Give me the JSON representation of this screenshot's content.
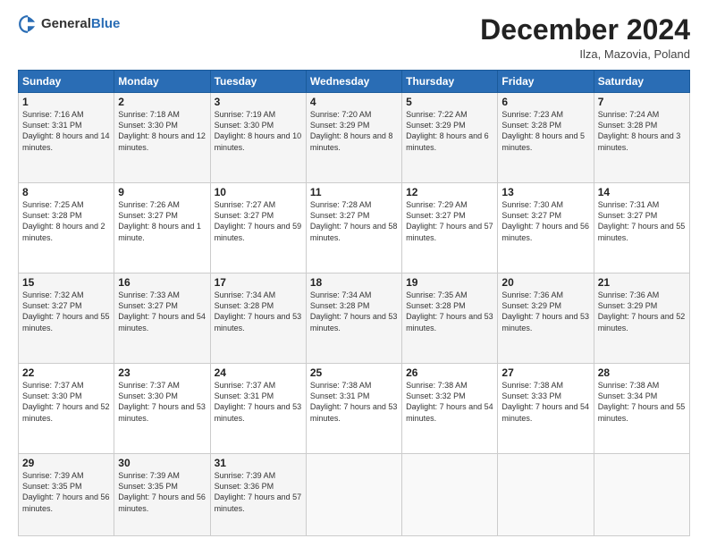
{
  "header": {
    "logo_general": "General",
    "logo_blue": "Blue",
    "month_title": "December 2024",
    "location": "Ilza, Mazovia, Poland"
  },
  "days_of_week": [
    "Sunday",
    "Monday",
    "Tuesday",
    "Wednesday",
    "Thursday",
    "Friday",
    "Saturday"
  ],
  "weeks": [
    [
      {
        "day": "1",
        "sunrise": "7:16 AM",
        "sunset": "3:31 PM",
        "daylight": "8 hours and 14 minutes."
      },
      {
        "day": "2",
        "sunrise": "7:18 AM",
        "sunset": "3:30 PM",
        "daylight": "8 hours and 12 minutes."
      },
      {
        "day": "3",
        "sunrise": "7:19 AM",
        "sunset": "3:30 PM",
        "daylight": "8 hours and 10 minutes."
      },
      {
        "day": "4",
        "sunrise": "7:20 AM",
        "sunset": "3:29 PM",
        "daylight": "8 hours and 8 minutes."
      },
      {
        "day": "5",
        "sunrise": "7:22 AM",
        "sunset": "3:29 PM",
        "daylight": "8 hours and 6 minutes."
      },
      {
        "day": "6",
        "sunrise": "7:23 AM",
        "sunset": "3:28 PM",
        "daylight": "8 hours and 5 minutes."
      },
      {
        "day": "7",
        "sunrise": "7:24 AM",
        "sunset": "3:28 PM",
        "daylight": "8 hours and 3 minutes."
      }
    ],
    [
      {
        "day": "8",
        "sunrise": "7:25 AM",
        "sunset": "3:28 PM",
        "daylight": "8 hours and 2 minutes."
      },
      {
        "day": "9",
        "sunrise": "7:26 AM",
        "sunset": "3:27 PM",
        "daylight": "8 hours and 1 minute."
      },
      {
        "day": "10",
        "sunrise": "7:27 AM",
        "sunset": "3:27 PM",
        "daylight": "7 hours and 59 minutes."
      },
      {
        "day": "11",
        "sunrise": "7:28 AM",
        "sunset": "3:27 PM",
        "daylight": "7 hours and 58 minutes."
      },
      {
        "day": "12",
        "sunrise": "7:29 AM",
        "sunset": "3:27 PM",
        "daylight": "7 hours and 57 minutes."
      },
      {
        "day": "13",
        "sunrise": "7:30 AM",
        "sunset": "3:27 PM",
        "daylight": "7 hours and 56 minutes."
      },
      {
        "day": "14",
        "sunrise": "7:31 AM",
        "sunset": "3:27 PM",
        "daylight": "7 hours and 55 minutes."
      }
    ],
    [
      {
        "day": "15",
        "sunrise": "7:32 AM",
        "sunset": "3:27 PM",
        "daylight": "7 hours and 55 minutes."
      },
      {
        "day": "16",
        "sunrise": "7:33 AM",
        "sunset": "3:27 PM",
        "daylight": "7 hours and 54 minutes."
      },
      {
        "day": "17",
        "sunrise": "7:34 AM",
        "sunset": "3:28 PM",
        "daylight": "7 hours and 53 minutes."
      },
      {
        "day": "18",
        "sunrise": "7:34 AM",
        "sunset": "3:28 PM",
        "daylight": "7 hours and 53 minutes."
      },
      {
        "day": "19",
        "sunrise": "7:35 AM",
        "sunset": "3:28 PM",
        "daylight": "7 hours and 53 minutes."
      },
      {
        "day": "20",
        "sunrise": "7:36 AM",
        "sunset": "3:29 PM",
        "daylight": "7 hours and 53 minutes."
      },
      {
        "day": "21",
        "sunrise": "7:36 AM",
        "sunset": "3:29 PM",
        "daylight": "7 hours and 52 minutes."
      }
    ],
    [
      {
        "day": "22",
        "sunrise": "7:37 AM",
        "sunset": "3:30 PM",
        "daylight": "7 hours and 52 minutes."
      },
      {
        "day": "23",
        "sunrise": "7:37 AM",
        "sunset": "3:30 PM",
        "daylight": "7 hours and 53 minutes."
      },
      {
        "day": "24",
        "sunrise": "7:37 AM",
        "sunset": "3:31 PM",
        "daylight": "7 hours and 53 minutes."
      },
      {
        "day": "25",
        "sunrise": "7:38 AM",
        "sunset": "3:31 PM",
        "daylight": "7 hours and 53 minutes."
      },
      {
        "day": "26",
        "sunrise": "7:38 AM",
        "sunset": "3:32 PM",
        "daylight": "7 hours and 54 minutes."
      },
      {
        "day": "27",
        "sunrise": "7:38 AM",
        "sunset": "3:33 PM",
        "daylight": "7 hours and 54 minutes."
      },
      {
        "day": "28",
        "sunrise": "7:38 AM",
        "sunset": "3:34 PM",
        "daylight": "7 hours and 55 minutes."
      }
    ],
    [
      {
        "day": "29",
        "sunrise": "7:39 AM",
        "sunset": "3:35 PM",
        "daylight": "7 hours and 56 minutes."
      },
      {
        "day": "30",
        "sunrise": "7:39 AM",
        "sunset": "3:35 PM",
        "daylight": "7 hours and 56 minutes."
      },
      {
        "day": "31",
        "sunrise": "7:39 AM",
        "sunset": "3:36 PM",
        "daylight": "7 hours and 57 minutes."
      },
      null,
      null,
      null,
      null
    ]
  ]
}
